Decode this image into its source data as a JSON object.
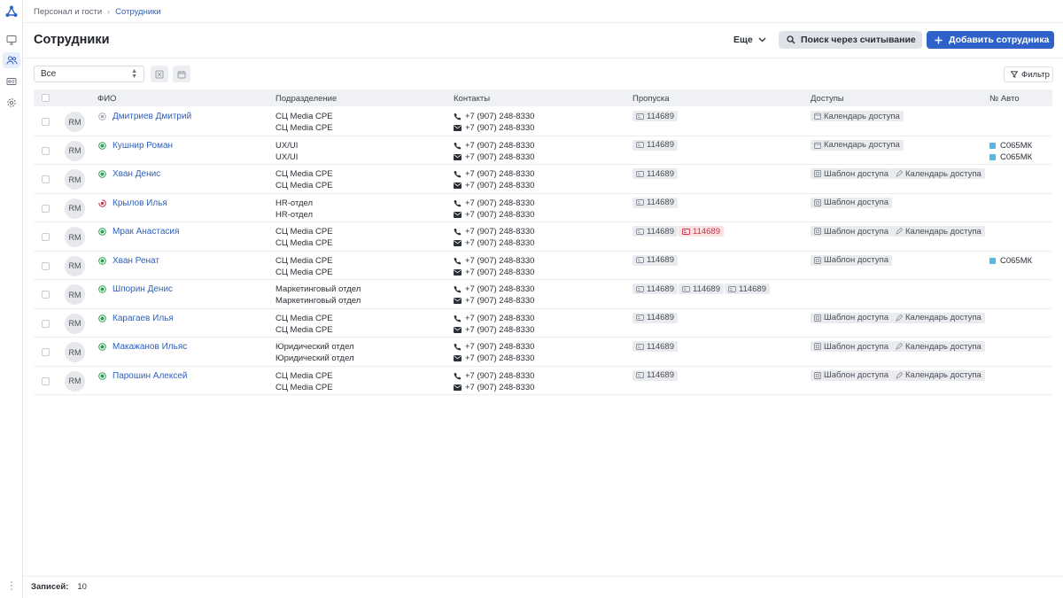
{
  "breadcrumb": {
    "parent": "Персонал и гости",
    "current": "Сотрудники"
  },
  "header": {
    "title": "Сотрудники",
    "more_label": "Еще",
    "scan_label": "Поиск через считывание",
    "add_label": "Добавить сотрудника"
  },
  "toolbar": {
    "select_value": "Все",
    "filter_label": "Фильтр"
  },
  "table": {
    "columns": {
      "name": "ФИО",
      "dept": "Подразделение",
      "contacts": "Контакты",
      "passes": "Пропуска",
      "access": "Доступы",
      "car": "№ Авто"
    },
    "rows": [
      {
        "initials": "RM",
        "status": "inactive",
        "name": "Дмитриев Дмитрий",
        "dept1": "СЦ Media CPE",
        "dept2": "СЦ Media CPE",
        "phone": "+7 (907) 248-8330",
        "email": "+7 (907) 248-8330",
        "passes": [
          "114689"
        ],
        "access": [
          "Календарь доступа"
        ],
        "cars": []
      },
      {
        "initials": "RM",
        "status": "active",
        "name": "Кушнир Роман",
        "dept1": "UX/UI",
        "dept2": "UX/UI",
        "phone": "+7 (907) 248-8330",
        "email": "+7 (907) 248-8330",
        "passes": [
          "114689"
        ],
        "access": [
          "Календарь доступа"
        ],
        "cars": [
          "С065МК",
          "С065МК"
        ]
      },
      {
        "initials": "RM",
        "status": "active",
        "name": "Хван Денис",
        "dept1": "СЦ Media CPE",
        "dept2": "СЦ Media CPE",
        "phone": "+7 (907) 248-8330",
        "email": "+7 (907) 248-8330",
        "passes": [
          "114689"
        ],
        "access": [
          "Шаблон доступа",
          "Календарь доступа"
        ],
        "cars": []
      },
      {
        "initials": "RM",
        "status": "blocked",
        "name": "Крылов Илья",
        "dept1": "HR-отдел",
        "dept2": "HR-отдел",
        "phone": "+7 (907) 248-8330",
        "email": "+7 (907) 248-8330",
        "passes": [
          "114689"
        ],
        "access": [
          "Шаблон доступа"
        ],
        "cars": []
      },
      {
        "initials": "RM",
        "status": "active",
        "name": "Мрак Анастасия",
        "dept1": "СЦ Media CPE",
        "dept2": "СЦ Media CPE",
        "phone": "+7 (907) 248-8330",
        "email": "+7 (907) 248-8330",
        "passes": [
          "114689",
          "114689"
        ],
        "access": [
          "Шаблон доступа",
          "Календарь доступа"
        ],
        "cars": []
      },
      {
        "initials": "RM",
        "status": "active",
        "name": "Хван Ренат",
        "dept1": "СЦ Media CPE",
        "dept2": "СЦ Media CPE",
        "phone": "+7 (907) 248-8330",
        "email": "+7 (907) 248-8330",
        "passes": [
          "114689"
        ],
        "access": [
          "Шаблон доступа"
        ],
        "cars": [
          "С065МК"
        ]
      },
      {
        "initials": "RM",
        "status": "active",
        "name": "Шпорин Денис",
        "dept1": "Маркетинговый отдел",
        "dept2": "Маркетинговый отдел",
        "phone": "+7 (907) 248-8330",
        "email": "+7 (907) 248-8330",
        "passes": [
          "114689",
          "114689",
          "114689"
        ],
        "access": [],
        "cars": []
      },
      {
        "initials": "RM",
        "status": "active",
        "name": "Карагаев Илья",
        "dept1": "СЦ Media CPE",
        "dept2": "СЦ Media CPE",
        "phone": "+7 (907) 248-8330",
        "email": "+7 (907) 248-8330",
        "passes": [
          "114689"
        ],
        "access": [
          "Шаблон доступа",
          "Календарь доступа"
        ],
        "cars": []
      },
      {
        "initials": "RM",
        "status": "active",
        "name": "Макажанов Ильяс",
        "dept1": "Юридический отдел",
        "dept2": "Юридический отдел",
        "phone": "+7 (907) 248-8330",
        "email": "+7 (907) 248-8330",
        "passes": [
          "114689"
        ],
        "access": [
          "Шаблон доступа",
          "Календарь доступа"
        ],
        "cars": []
      },
      {
        "initials": "RM",
        "status": "active",
        "name": "Парошин Алексей",
        "dept1": "СЦ Media CPE",
        "dept2": "СЦ Media CPE",
        "phone": "+7 (907) 248-8330",
        "email": "+7 (907) 248-8330",
        "passes": [
          "114689"
        ],
        "access": [
          "Шаблон доступа",
          "Календарь доступа"
        ],
        "cars": []
      }
    ]
  },
  "footer": {
    "records_label": "Записей:",
    "records_count": "10"
  },
  "colors": {
    "accent": "#2f62c9",
    "link": "#2f5fb8",
    "active": "#2e9b4f",
    "blocked": "#c6354a",
    "car": "#56b7e6"
  }
}
